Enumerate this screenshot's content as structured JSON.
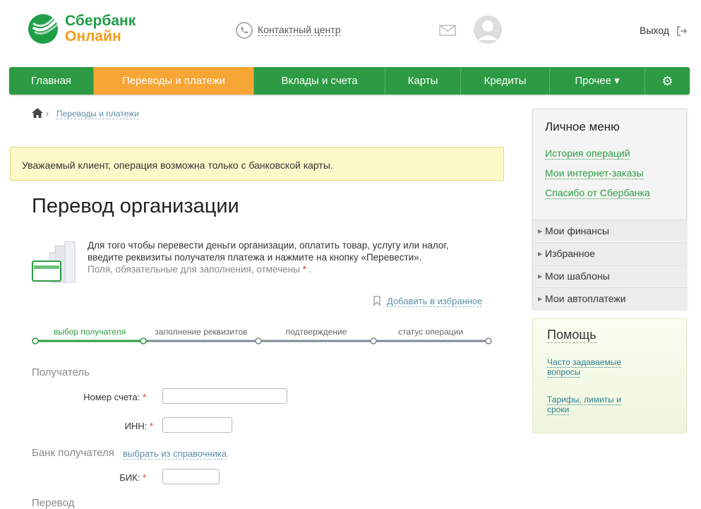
{
  "header": {
    "brand_line1": "Сбербанк",
    "brand_line2": "Онлайн",
    "contact_label": "Контактный центр",
    "logout_label": "Выход"
  },
  "nav": {
    "items": [
      {
        "label": "Главная"
      },
      {
        "label": "Переводы и платежи"
      },
      {
        "label": "Вклады и счета"
      },
      {
        "label": "Карты"
      },
      {
        "label": "Кредиты"
      },
      {
        "label": "Прочее ▾"
      }
    ],
    "active_index": 1
  },
  "breadcrumb": {
    "current": "Переводы и платежи"
  },
  "notice": "Уважаемый клиент, операция возможна только с банковской карты.",
  "page_title": "Перевод организации",
  "description": {
    "line1": "Для того чтобы перевести деньги организации, оплатить товар, услугу или налог,",
    "line2": "введите реквизиты получателя платежа и нажмите на кнопку «Перевести».",
    "line3_text": "Поля, обязательные для заполнения, отмечены",
    "line3_star": "*",
    "line3_end": "."
  },
  "add_favorite": "Добавить в избранное",
  "steps": [
    {
      "label": "выбор получателя"
    },
    {
      "label": "заполнение реквизитов"
    },
    {
      "label": "подтверждение"
    },
    {
      "label": "статус операции"
    }
  ],
  "form": {
    "section_recipient": "Получатель",
    "account_label": "Номер счета:",
    "inn_label": "ИНН:",
    "section_bank": "Банк получателя",
    "choose_directory": "выбрать из справочника",
    "bik_label": "БИК:",
    "section_transfer": "Перевод",
    "required_mark": "*"
  },
  "sidebar": {
    "personal_title": "Личное меню",
    "links": [
      "История операций",
      "Мои интернет-заказы",
      "Спасибо от Сбербанка"
    ],
    "rows": [
      "Мои финансы",
      "Избранное",
      "Мои шаблоны",
      "Мои автоплатежи"
    ],
    "help_title": "Помощь",
    "help_links": [
      {
        "line1": "Часто задаваемые",
        "line2": "вопросы"
      },
      {
        "line1": "Тарифы, лимиты и",
        "line2": "сроки"
      }
    ]
  },
  "colors": {
    "brand_green": "#2d9b43",
    "accent_orange": "#f7a535",
    "logo_orange": "#f29d1a"
  }
}
